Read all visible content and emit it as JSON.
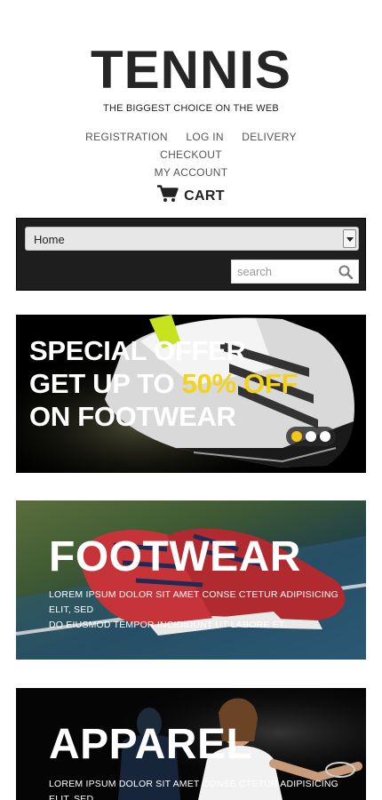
{
  "header": {
    "brand": "TENNIS",
    "tagline": "THE BIGGEST CHOICE ON THE WEB"
  },
  "nav": {
    "items": [
      {
        "label": "REGISTRATION"
      },
      {
        "label": "LOG IN"
      },
      {
        "label": "DELIVERY"
      },
      {
        "label": "CHECKOUT"
      },
      {
        "label": "MY ACCOUNT"
      }
    ]
  },
  "cart": {
    "label": "CART",
    "icon": "cart-icon"
  },
  "toolbar": {
    "category_select": {
      "value": "Home"
    },
    "search": {
      "placeholder": "search",
      "value": "",
      "icon": "search-icon"
    }
  },
  "banners": {
    "offer": {
      "line1": "SPECIAL OFFER",
      "line2_prefix": "GET UP TO ",
      "line2_highlight": "50% OFF",
      "line3": "ON FOOTWEAR",
      "slider_dots": 3,
      "active_dot": 1
    },
    "footwear": {
      "title": "FOOTWEAR",
      "desc_line1": "LOREM IPSUM DOLOR SIT AMET CONSE CTETUR ADIPISICING",
      "desc_line2": "ELIT, SED",
      "desc_line3": "DO EIUSMOD TEMPOR INCIDIDUNT UT LABORE ET."
    },
    "apparel": {
      "title": "APPAREL",
      "desc_line1": "LOREM IPSUM DOLOR SIT AMET CONSE CTETUR ADIPISICING",
      "desc_line2": "ELIT, SED"
    }
  },
  "colors": {
    "highlight": "#f2d21b",
    "panel_bg": "#1e1e1e",
    "text_dark": "#262626"
  }
}
